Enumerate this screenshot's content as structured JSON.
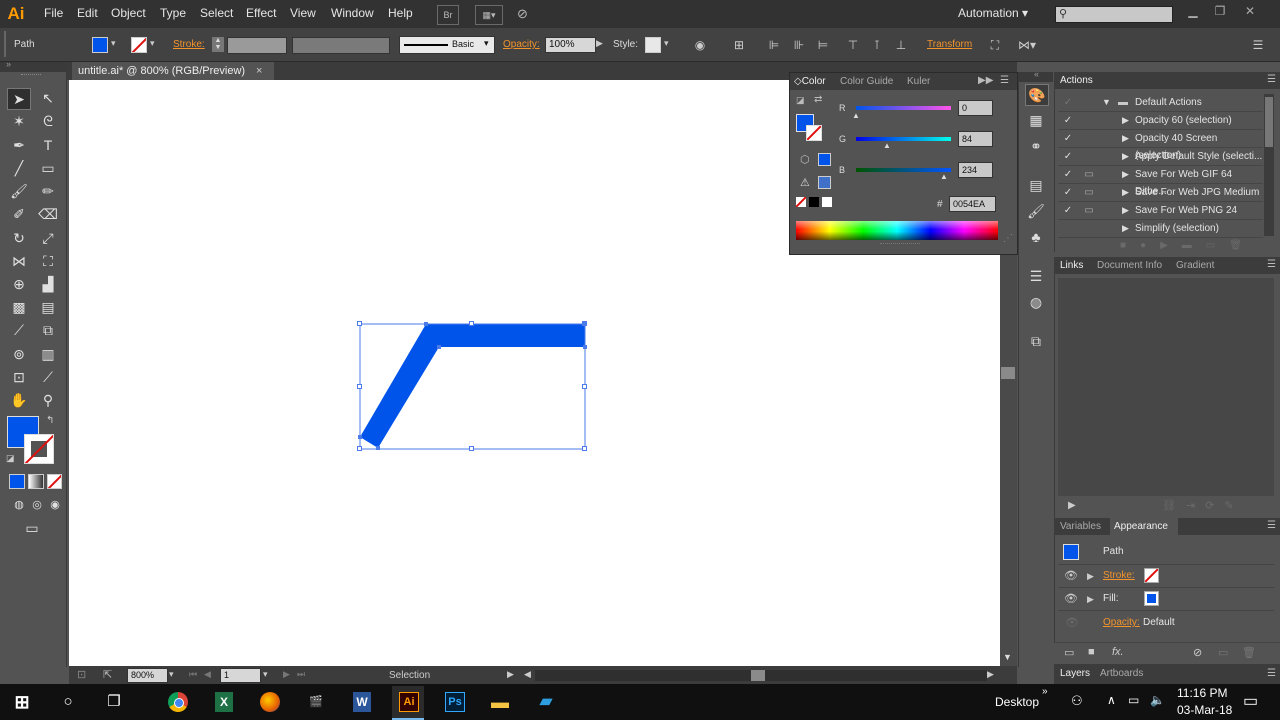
{
  "menubar": {
    "app_logo": "Ai",
    "items": [
      "File",
      "Edit",
      "Object",
      "Type",
      "Select",
      "Effect",
      "View",
      "Window",
      "Help"
    ],
    "bridge_label": "Br",
    "workspace": "Automation",
    "workspace_arrow": "▾",
    "search_placeholder": ""
  },
  "controlbar": {
    "selection_type": "Path",
    "stroke_label": "Stroke:",
    "brush_style": "Basic",
    "opacity_label": "Opacity:",
    "opacity_value": "100%",
    "style_label": "Style:",
    "transform_label": "Transform"
  },
  "document": {
    "tab_title": "untitle.ai* @ 800% (RGB/Preview)",
    "tab_close": "×",
    "zoom": "800%",
    "page": "1",
    "status": "Selection"
  },
  "color_panel": {
    "tabs": [
      "Color",
      "Color Guide",
      "Kuler"
    ],
    "r_label": "R",
    "r_value": "0",
    "g_label": "G",
    "g_value": "84",
    "b_label": "B",
    "b_value": "234",
    "hash_label": "#",
    "hex_value": "0054EA",
    "fill_color": "#0054EA"
  },
  "actions_panel": {
    "title": "Actions",
    "set_name": "Default Actions",
    "items": [
      "Opacity 60 (selection)",
      "Opacity 40 Screen (selection)",
      "Apply Default Style (selecti...",
      "Save For Web GIF 64 Dithe...",
      "Save For Web JPG Medium",
      "Save For Web PNG 24",
      "Simplify (selection)"
    ]
  },
  "links_panel": {
    "tabs": [
      "Links",
      "Document Info",
      "Gradient"
    ]
  },
  "appearance_panel": {
    "tabs": [
      "Variables",
      "Appearance"
    ],
    "object_type": "Path",
    "stroke_label": "Stroke:",
    "fill_label": "Fill:",
    "opacity_label": "Opacity:",
    "opacity_value": "Default",
    "fx_label": "fx."
  },
  "bottom_tabs": [
    "Layers",
    "Artboards"
  ],
  "taskbar": {
    "desktop_label": "Desktop",
    "time": "11:16 PM",
    "date": "03-Mar-18"
  }
}
